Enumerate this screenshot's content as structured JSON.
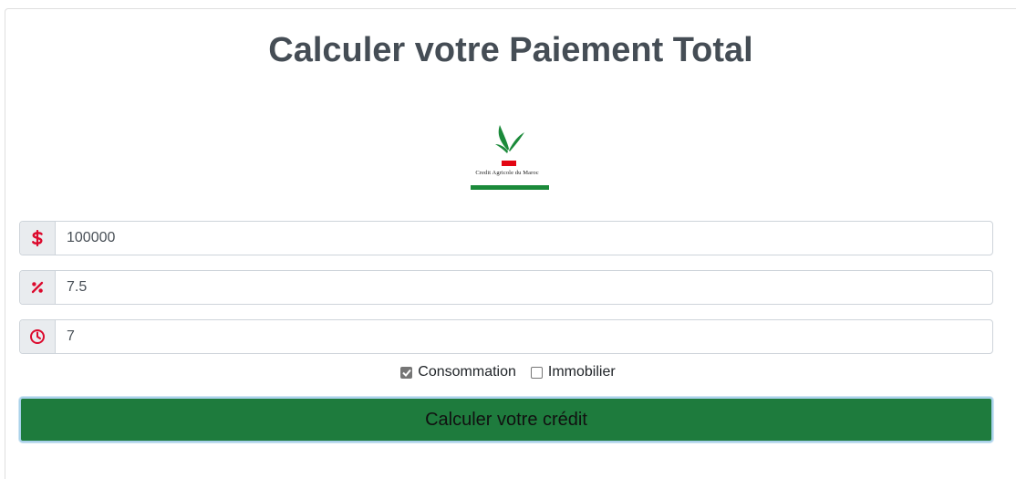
{
  "page": {
    "title": "Calculer votre Paiement Total"
  },
  "logo": {
    "text": "Credit Agricole du Maroc",
    "icon": "leaf-logo"
  },
  "inputs": [
    {
      "icon": "dollar-icon",
      "value": "100000"
    },
    {
      "icon": "percent-icon",
      "value": "7.5"
    },
    {
      "icon": "clock-icon",
      "value": "7"
    }
  ],
  "options": [
    {
      "label": "Consommation",
      "checked": true
    },
    {
      "label": "Immobilier",
      "checked": false
    }
  ],
  "submit": {
    "label": "Calculer votre crédit"
  },
  "colors": {
    "icon_red": "#dc0a2d",
    "button_green": "#1e7b3d",
    "logo_green": "#1b8a3a",
    "logo_red": "#e30613"
  }
}
